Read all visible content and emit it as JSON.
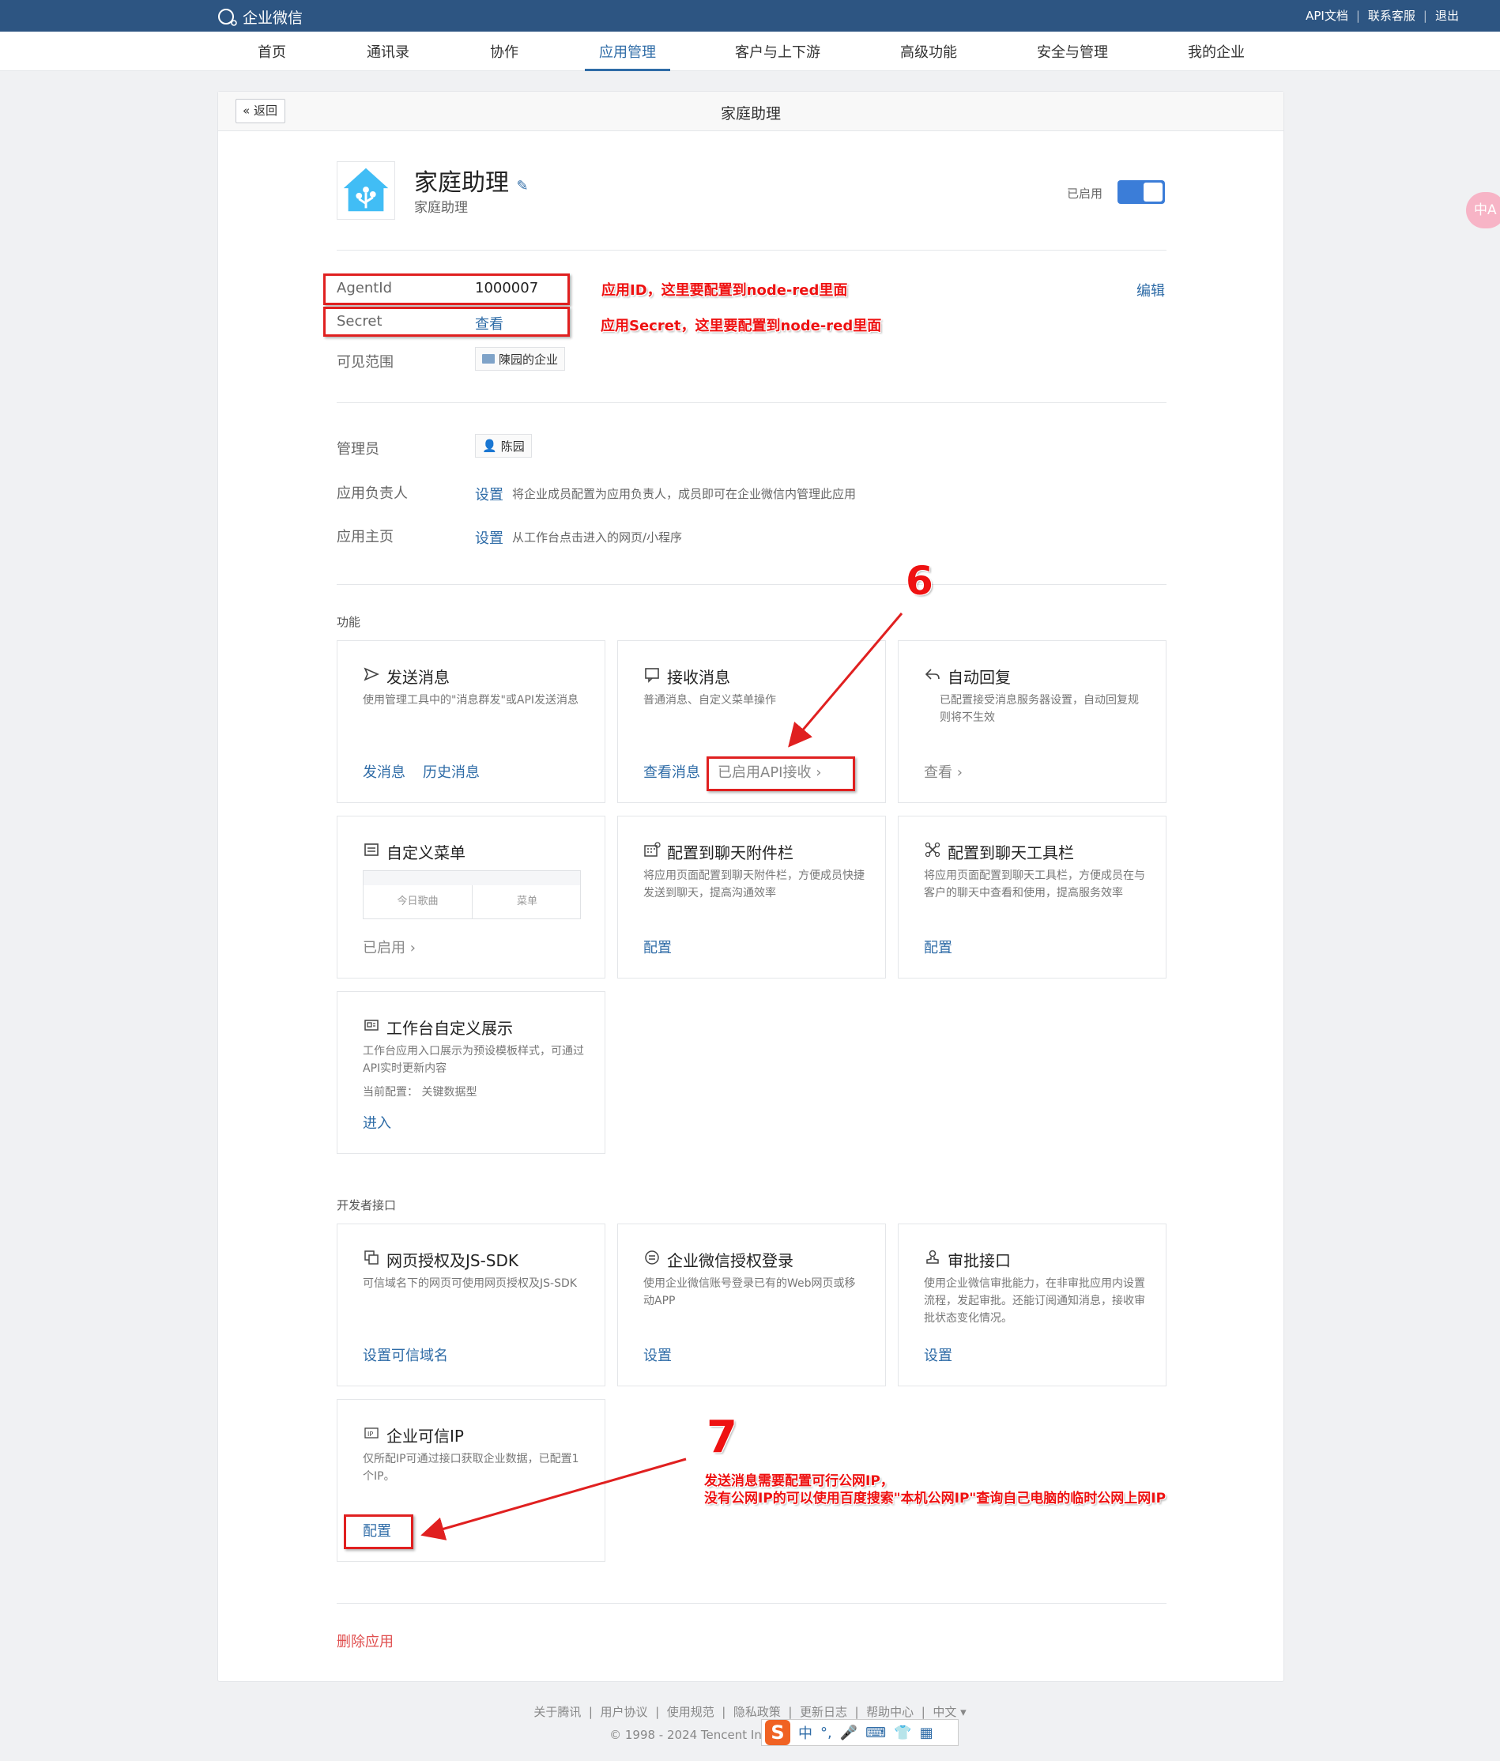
{
  "topbar": {
    "logo_text": "企业微信",
    "links": [
      "API文档",
      "联系客服",
      "退出"
    ]
  },
  "nav": {
    "items": [
      "首页",
      "通讯录",
      "协作",
      "应用管理",
      "客户与上下游",
      "高级功能",
      "安全与管理",
      "我的企业"
    ],
    "active": "应用管理"
  },
  "header": {
    "back_label": "返回",
    "title": "家庭助理"
  },
  "app": {
    "name": "家庭助理",
    "description": "家庭助理",
    "status_label": "已启用",
    "enabled": true
  },
  "info": {
    "agentid_label": "AgentId",
    "agentid_value": "1000007",
    "secret_label": "Secret",
    "secret_link": "查看",
    "scope_label": "可见范围",
    "scope_value": "陳园的企业",
    "edit_label": "编辑"
  },
  "annotations": {
    "agentid_note": "应用ID，这里要配置到node-red里面",
    "secret_note": "应用Secret，这里要配置到node-red里面",
    "step6": "6",
    "step7": "7",
    "ip_note_1": "发送消息需要配置可行公网IP，",
    "ip_note_2": "没有公网IP的可以使用百度搜索\"本机公网IP\"查询自己电脑的临时公网上网IP"
  },
  "admin": {
    "admin_label": "管理员",
    "admin_value": "陈园",
    "owner_label": "应用负责人",
    "owner_link": "设置",
    "owner_hint": "将企业成员配置为应用负责人，成员即可在企业微信内管理此应用",
    "home_label": "应用主页",
    "home_link": "设置",
    "home_hint": "从工作台点击进入的网页/小程序"
  },
  "features": {
    "section_title": "功能",
    "send": {
      "title": "发送消息",
      "desc": "使用管理工具中的\"消息群发\"或API发送消息",
      "action1": "发消息",
      "action2": "历史消息"
    },
    "receive": {
      "title": "接收消息",
      "desc": "普通消息、自定义菜单操作",
      "action1": "查看消息",
      "action2": "已启用API接收 ›"
    },
    "autoreply": {
      "title": "自动回复",
      "desc": "已配置接受消息服务器设置，自动回复规则将不生效",
      "action1": "查看 ›"
    },
    "menu": {
      "title": "自定义菜单",
      "tab1": "今日歌曲",
      "tab2": "菜单",
      "action1": "已启用 ›"
    },
    "attach": {
      "title": "配置到聊天附件栏",
      "desc": "将应用页面配置到聊天附件栏，方便成员快捷发送到聊天，提高沟通效率",
      "action1": "配置"
    },
    "toolbar": {
      "title": "配置到聊天工具栏",
      "desc": "将应用页面配置到聊天工具栏，方便成员在与客户的聊天中查看和使用，提高服务效率",
      "action1": "配置"
    },
    "workbench": {
      "title": "工作台自定义展示",
      "desc": "工作台应用入口展示为预设模板样式，可通过API实时更新内容",
      "current": "当前配置：  关键数据型",
      "action1": "进入"
    }
  },
  "developer": {
    "section_title": "开发者接口",
    "web": {
      "title": "网页授权及JS-SDK",
      "desc": "可信域名下的网页可使用网页授权及JS-SDK",
      "action1": "设置可信域名"
    },
    "login": {
      "title": "企业微信授权登录",
      "desc": "使用企业微信账号登录已有的Web网页或移动APP",
      "action1": "设置"
    },
    "approval": {
      "title": "审批接口",
      "desc": "使用企业微信审批能力，在非审批应用内设置流程，发起审批。还能订阅通知消息，接收审批状态变化情况。",
      "action1": "设置"
    },
    "ip": {
      "title": "企业可信IP",
      "desc": "仅所配IP可通过接口获取企业数据，已配置1个IP。",
      "action1": "配置"
    }
  },
  "delete_label": "删除应用",
  "footer": {
    "links": [
      "关于腾讯",
      "用户协议",
      "使用规范",
      "隐私政策",
      "更新日志",
      "帮助中心",
      "中文 ▾"
    ],
    "copyright": "© 1998 - 2024 Tencent Inc. All Rights Reserved"
  },
  "overlays": {
    "translate": "中A",
    "ime": "中"
  },
  "colors": {
    "brand": "#2d5582",
    "link": "#2f6ca7",
    "annotation": "#ee1111",
    "danger": "#e05050"
  }
}
